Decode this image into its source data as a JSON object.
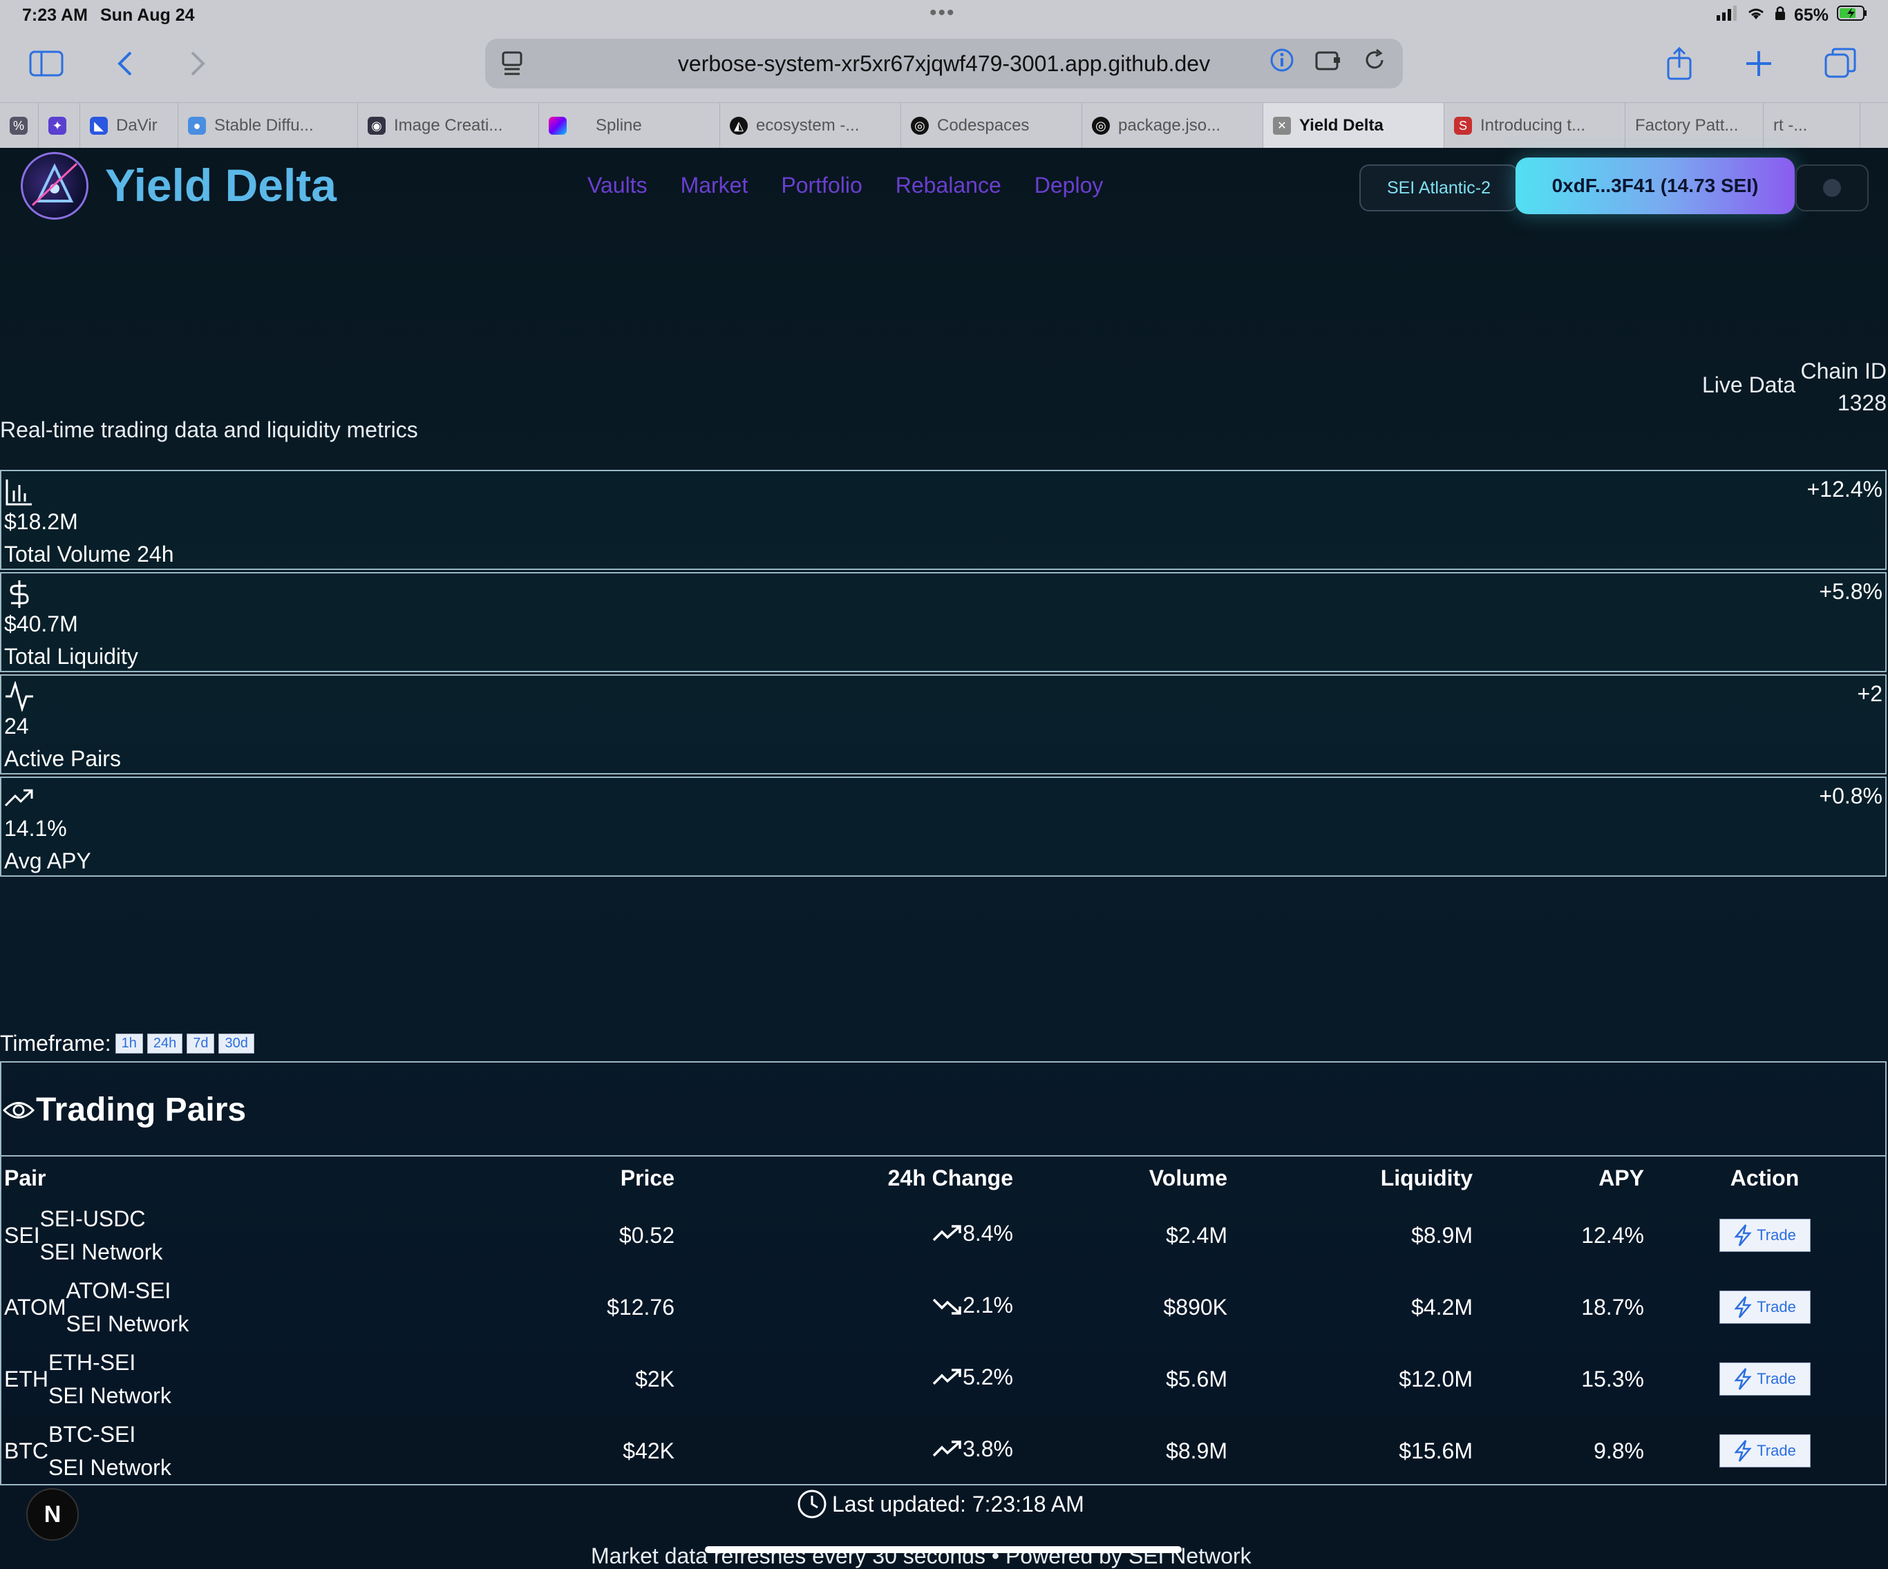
{
  "status_bar": {
    "time": "7:23 AM",
    "date": "Sun Aug 24",
    "battery": "65%"
  },
  "browser": {
    "url": "verbose-system-xr5xr67xjqwf479-3001.app.github.dev",
    "tabs": [
      {
        "label": "",
        "icon": "percent-icon",
        "color": "#556"
      },
      {
        "label": "",
        "icon": "star-shape-icon",
        "color": "#5b3fd0"
      },
      {
        "label": "DaVir",
        "icon": "davinci-icon",
        "color": "#2a56e0"
      },
      {
        "label": "Stable Diffu...",
        "icon": "stable-diffusion-icon",
        "color": "#4a8ee0"
      },
      {
        "label": "Image Creati...",
        "icon": "image-creator-icon",
        "color": "#334"
      },
      {
        "label": "Spline",
        "icon": "spline-icon",
        "color": "#a060e0"
      },
      {
        "label": "ecosystem -...",
        "icon": "ecosystem-icon",
        "color": "#111"
      },
      {
        "label": "Codespaces",
        "icon": "github-icon",
        "color": "#111"
      },
      {
        "label": "package.jso...",
        "icon": "github-icon",
        "color": "#111"
      },
      {
        "label": "Yield Delta",
        "icon": "close-icon",
        "color": "#666",
        "active": true
      },
      {
        "label": "Introducing t...",
        "icon": "sei-icon",
        "color": "#c83030"
      },
      {
        "label": "Factory Patt...",
        "icon": "",
        "color": ""
      },
      {
        "label": "rt -...",
        "icon": "",
        "color": ""
      }
    ]
  },
  "app": {
    "brand": "Yield Delta",
    "nav": [
      "Vaults",
      "Market",
      "Portfolio",
      "Rebalance",
      "Deploy"
    ],
    "network": "SEI Atlantic-2",
    "wallet": "0xdF...3F41 (14.73 SEI)",
    "live_data": "Live Data",
    "chain_id_label": "Chain ID",
    "chain_id": "1328",
    "subtitle": "Real-time trading data and liquidity metrics"
  },
  "metrics": [
    {
      "icon": "bar-chart-icon",
      "value": "$18.2M",
      "label": "Total Volume 24h",
      "change": "+12.4%"
    },
    {
      "icon": "dollar-icon",
      "value": "$40.7M",
      "label": "Total Liquidity",
      "change": "+5.8%"
    },
    {
      "icon": "activity-icon",
      "value": "24",
      "label": "Active Pairs",
      "change": "+2"
    },
    {
      "icon": "trending-up-icon",
      "value": "14.1%",
      "label": "Avg APY",
      "change": "+0.8%"
    }
  ],
  "timeframe": {
    "label": "Timeframe:",
    "options": [
      "1h",
      "24h",
      "7d",
      "30d"
    ]
  },
  "trading_pairs": {
    "title": "Trading Pairs",
    "columns": [
      "Pair",
      "Price",
      "24h Change",
      "Volume",
      "Liquidity",
      "APY",
      "Action"
    ],
    "rows": [
      {
        "symbol": "SEI",
        "pair": "SEI-USDC",
        "network": "SEI Network",
        "price": "$0.52",
        "change": "8.4%",
        "trend": "up",
        "volume": "$2.4M",
        "liquidity": "$8.9M",
        "apy": "12.4%",
        "action": "Trade"
      },
      {
        "symbol": "ATOM",
        "pair": "ATOM-SEI",
        "network": "SEI Network",
        "price": "$12.76",
        "change": "2.1%",
        "trend": "down",
        "volume": "$890K",
        "liquidity": "$4.2M",
        "apy": "18.7%",
        "action": "Trade"
      },
      {
        "symbol": "ETH",
        "pair": "ETH-SEI",
        "network": "SEI Network",
        "price": "$2K",
        "change": "5.2%",
        "trend": "up",
        "volume": "$5.6M",
        "liquidity": "$12.0M",
        "apy": "15.3%",
        "action": "Trade"
      },
      {
        "symbol": "BTC",
        "pair": "BTC-SEI",
        "network": "SEI Network",
        "price": "$42K",
        "change": "3.8%",
        "trend": "up",
        "volume": "$8.9M",
        "liquidity": "$15.6M",
        "apy": "9.8%",
        "action": "Trade"
      }
    ]
  },
  "last_updated": "Last updated: 7:23:18 AM",
  "footer_note": "Market data refreshes every 30 seconds • Powered by SEI Network",
  "badge": "N"
}
